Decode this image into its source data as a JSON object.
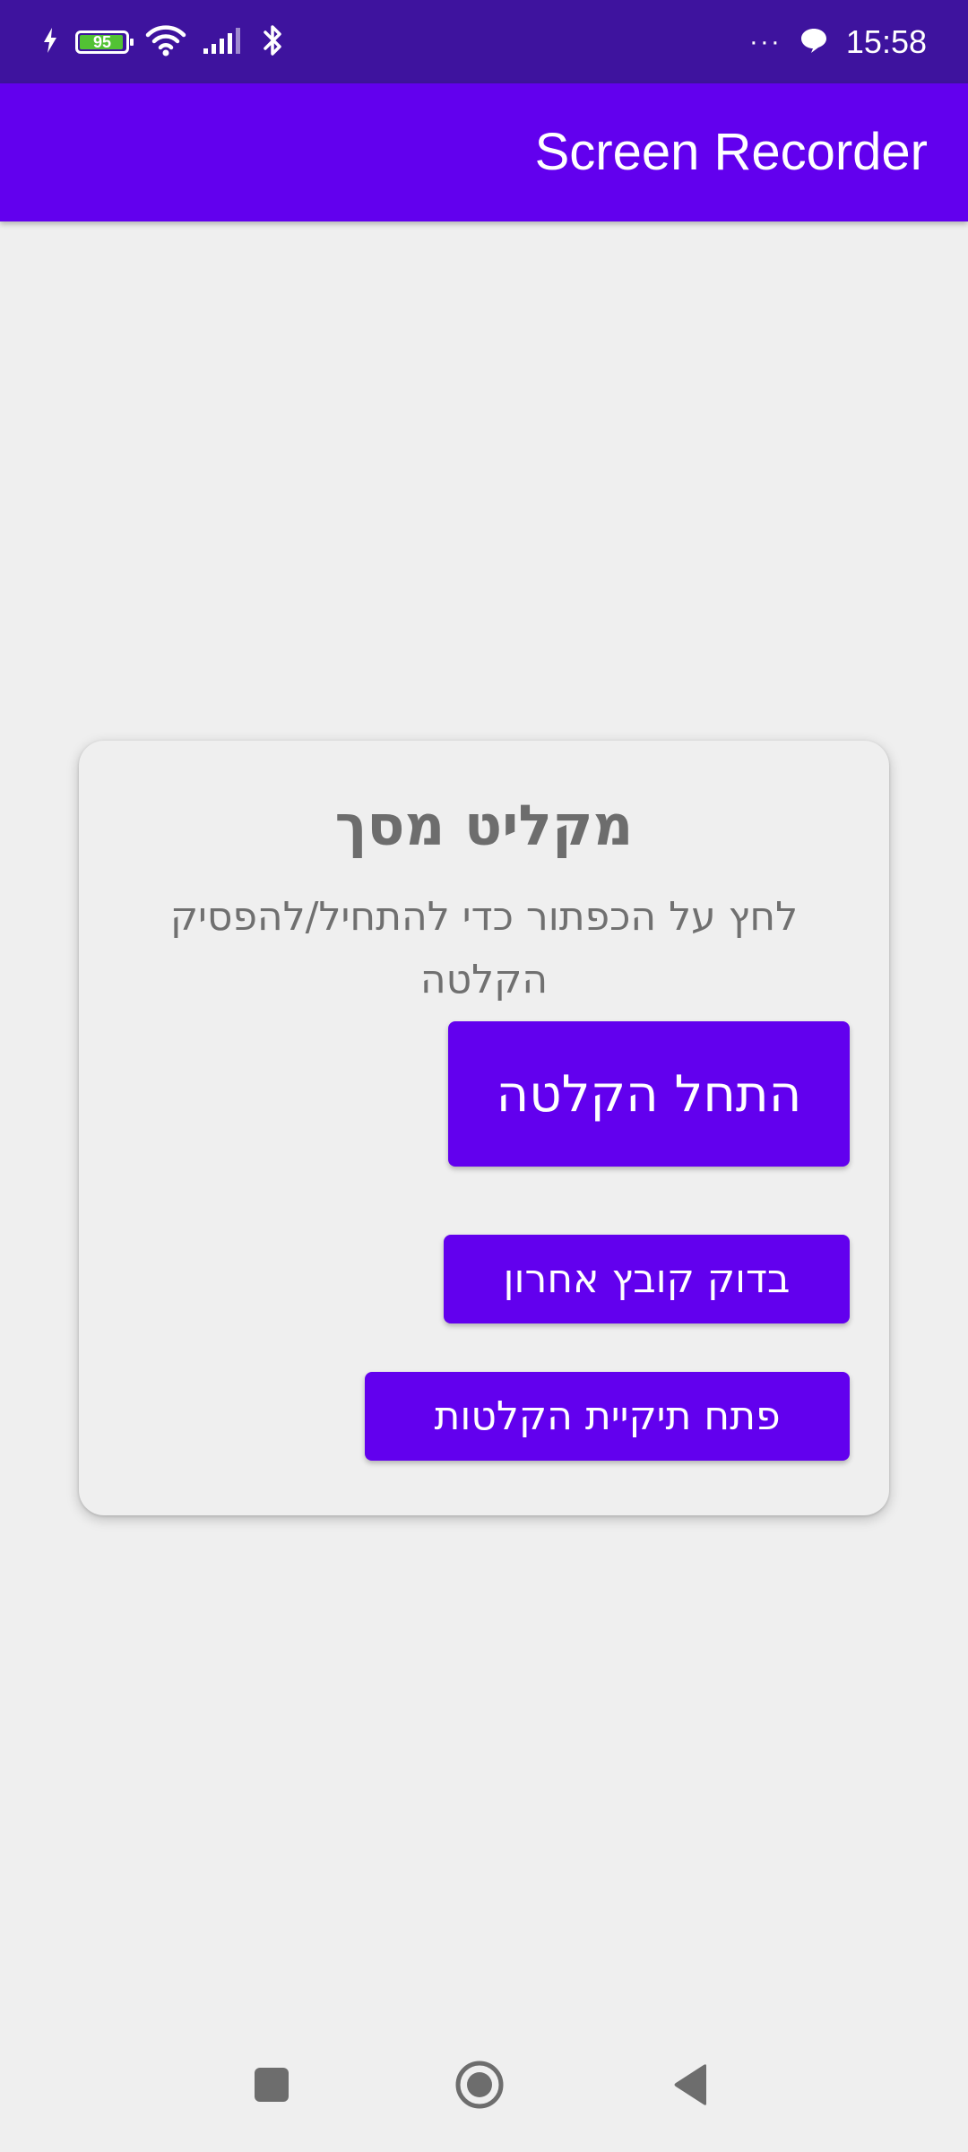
{
  "status_bar": {
    "battery_level": "95",
    "battery_fraction": 0.95,
    "overflow_dots": "···",
    "time": "15:58",
    "icons": [
      "charging-icon",
      "battery-icon",
      "wifi-icon",
      "signal-icon",
      "bluetooth-icon",
      "overflow-icon",
      "chat-bubble-icon"
    ]
  },
  "app_bar": {
    "title": "Screen Recorder"
  },
  "card": {
    "title": "מקליט מסך",
    "subtitle": "לחץ על הכפתור כדי להתחיל/להפסיק הקלטה",
    "start_button": "התחל הקלטה",
    "check_last_button": "בדוק קובץ אחרון",
    "open_folder_button": "פתח תיקיית הקלטות"
  },
  "nav_bar": {
    "icons": [
      "recent-apps-icon",
      "home-icon",
      "back-icon"
    ]
  },
  "colors": {
    "status_bar": "#3e139e",
    "app_bar": "#6200ee",
    "accent": "#6200ee",
    "background": "#efefef",
    "card_text": "#6d6d6d",
    "nav_icons": "#6d6d6d"
  }
}
